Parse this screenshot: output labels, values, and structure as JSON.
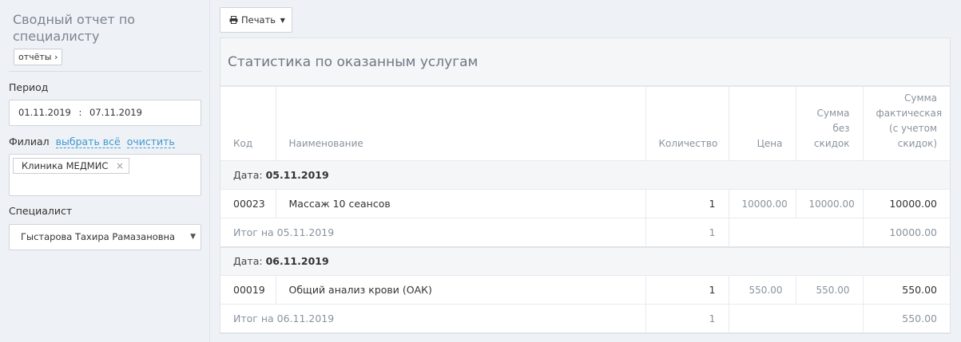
{
  "sidebar": {
    "title": "Сводный отчет по специалисту",
    "reports_label": "отчёты",
    "period_label": "Период",
    "date_from": "01.11.2019",
    "date_sep": ":",
    "date_to": "07.11.2019",
    "branch_label": "Филиал",
    "select_all": "выбрать всё",
    "clear": "очистить",
    "branch_tag": "Клиника МЕДМИС",
    "specialist_label": "Специалист",
    "specialist_value": "Гыстарова Тахира Рамазановна"
  },
  "toolbar": {
    "print_label": "Печать"
  },
  "panel": {
    "title": "Статистика по оказанным услугам",
    "columns": {
      "code": "Код",
      "name": "Наименование",
      "qty": "Количество",
      "price": "Цена",
      "sum_line1": "Сумма",
      "sum_line2": "без",
      "sum_line3": "скидок",
      "fact_line1": "Сумма",
      "fact_line2": "фактическая",
      "fact_line3": "(с учетом",
      "fact_line4": "скидок)"
    },
    "groups": [
      {
        "date_prefix": "Дата:",
        "date": "05.11.2019",
        "item": {
          "code": "00023",
          "name": "Массаж 10 сеансов",
          "qty": "1",
          "price": "10000.00",
          "sum": "10000.00",
          "fact": "10000.00"
        },
        "total": {
          "label": "Итог на 05.11.2019",
          "qty": "1",
          "fact": "10000.00"
        }
      },
      {
        "date_prefix": "Дата:",
        "date": "06.11.2019",
        "item": {
          "code": "00019",
          "name": "Общий анализ крови (ОАК)",
          "qty": "1",
          "price": "550.00",
          "sum": "550.00",
          "fact": "550.00"
        },
        "total": {
          "label": "Итог на 06.11.2019",
          "qty": "1",
          "fact": "550.00"
        }
      }
    ]
  }
}
